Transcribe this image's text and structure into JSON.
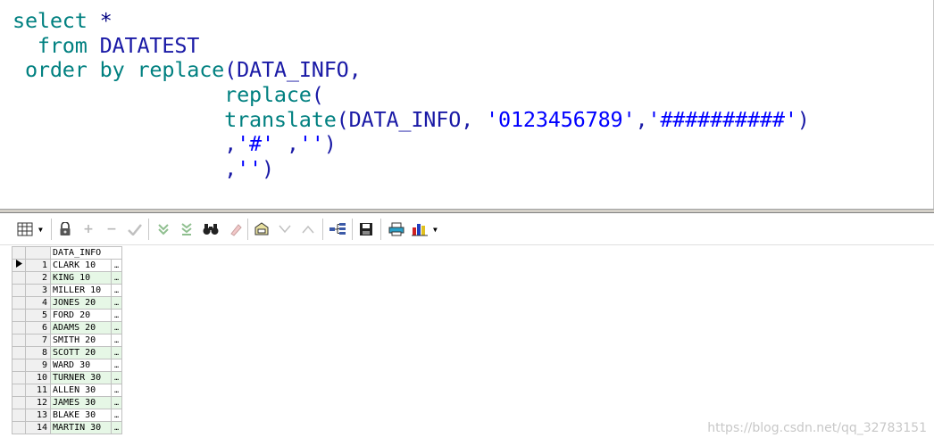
{
  "editor": {
    "sql_lines": [
      [
        {
          "t": "select ",
          "c": "kw"
        },
        {
          "t": "*",
          "c": "op"
        }
      ],
      [
        {
          "t": "  from ",
          "c": "kw"
        },
        {
          "t": "DATATEST",
          "c": "ident"
        }
      ],
      [
        {
          "t": " order by ",
          "c": "kw"
        },
        {
          "t": "replace",
          "c": "kw"
        },
        {
          "t": "(DATA_INFO,",
          "c": "ident"
        }
      ],
      [
        {
          "t": "                 replace",
          "c": "kw"
        },
        {
          "t": "(",
          "c": "ident"
        }
      ],
      [
        {
          "t": "                 translate",
          "c": "kw"
        },
        {
          "t": "(DATA_INFO, ",
          "c": "ident"
        },
        {
          "t": "'0123456789'",
          "c": "str"
        },
        {
          "t": ",",
          "c": "ident"
        },
        {
          "t": "'##########'",
          "c": "str"
        },
        {
          "t": ")",
          "c": "ident"
        }
      ],
      [
        {
          "t": "                 ,",
          "c": "ident"
        },
        {
          "t": "'#'",
          "c": "str"
        },
        {
          "t": " ,",
          "c": "ident"
        },
        {
          "t": "''",
          "c": "str"
        },
        {
          "t": ")",
          "c": "ident"
        }
      ],
      [
        {
          "t": "                 ,",
          "c": "ident"
        },
        {
          "t": "''",
          "c": "str"
        },
        {
          "t": ")",
          "c": "ident"
        }
      ]
    ]
  },
  "toolbar": {
    "icons": [
      "grid-view-icon",
      "lock-icon",
      "add-record-icon",
      "delete-record-icon",
      "post-changes-icon",
      "fetch-next-icon",
      "fetch-last-icon",
      "find-icon",
      "clear-icon",
      "query-by-example-icon",
      "next-record-icon",
      "previous-record-icon",
      "export-tree-icon",
      "save-icon",
      "print-icon",
      "chart-icon"
    ]
  },
  "grid": {
    "column_header": "DATA_INFO",
    "ellipsis": "…",
    "rows": [
      {
        "n": "1",
        "v": "CLARK 10"
      },
      {
        "n": "2",
        "v": "KING 10"
      },
      {
        "n": "3",
        "v": "MILLER 10"
      },
      {
        "n": "4",
        "v": "JONES 20"
      },
      {
        "n": "5",
        "v": "FORD 20"
      },
      {
        "n": "6",
        "v": "ADAMS 20"
      },
      {
        "n": "7",
        "v": "SMITH 20"
      },
      {
        "n": "8",
        "v": "SCOTT 20"
      },
      {
        "n": "9",
        "v": "WARD 30"
      },
      {
        "n": "10",
        "v": "TURNER 30"
      },
      {
        "n": "11",
        "v": "ALLEN 30"
      },
      {
        "n": "12",
        "v": "JAMES 30"
      },
      {
        "n": "13",
        "v": "BLAKE 30"
      },
      {
        "n": "14",
        "v": "MARTIN 30"
      }
    ]
  },
  "watermark": "https://blog.csdn.net/qq_32783151",
  "colors": {
    "keyword": "#008080",
    "identifier": "#1a1aa6",
    "string": "#0000ff",
    "row_alt": "#e6f7e6"
  }
}
